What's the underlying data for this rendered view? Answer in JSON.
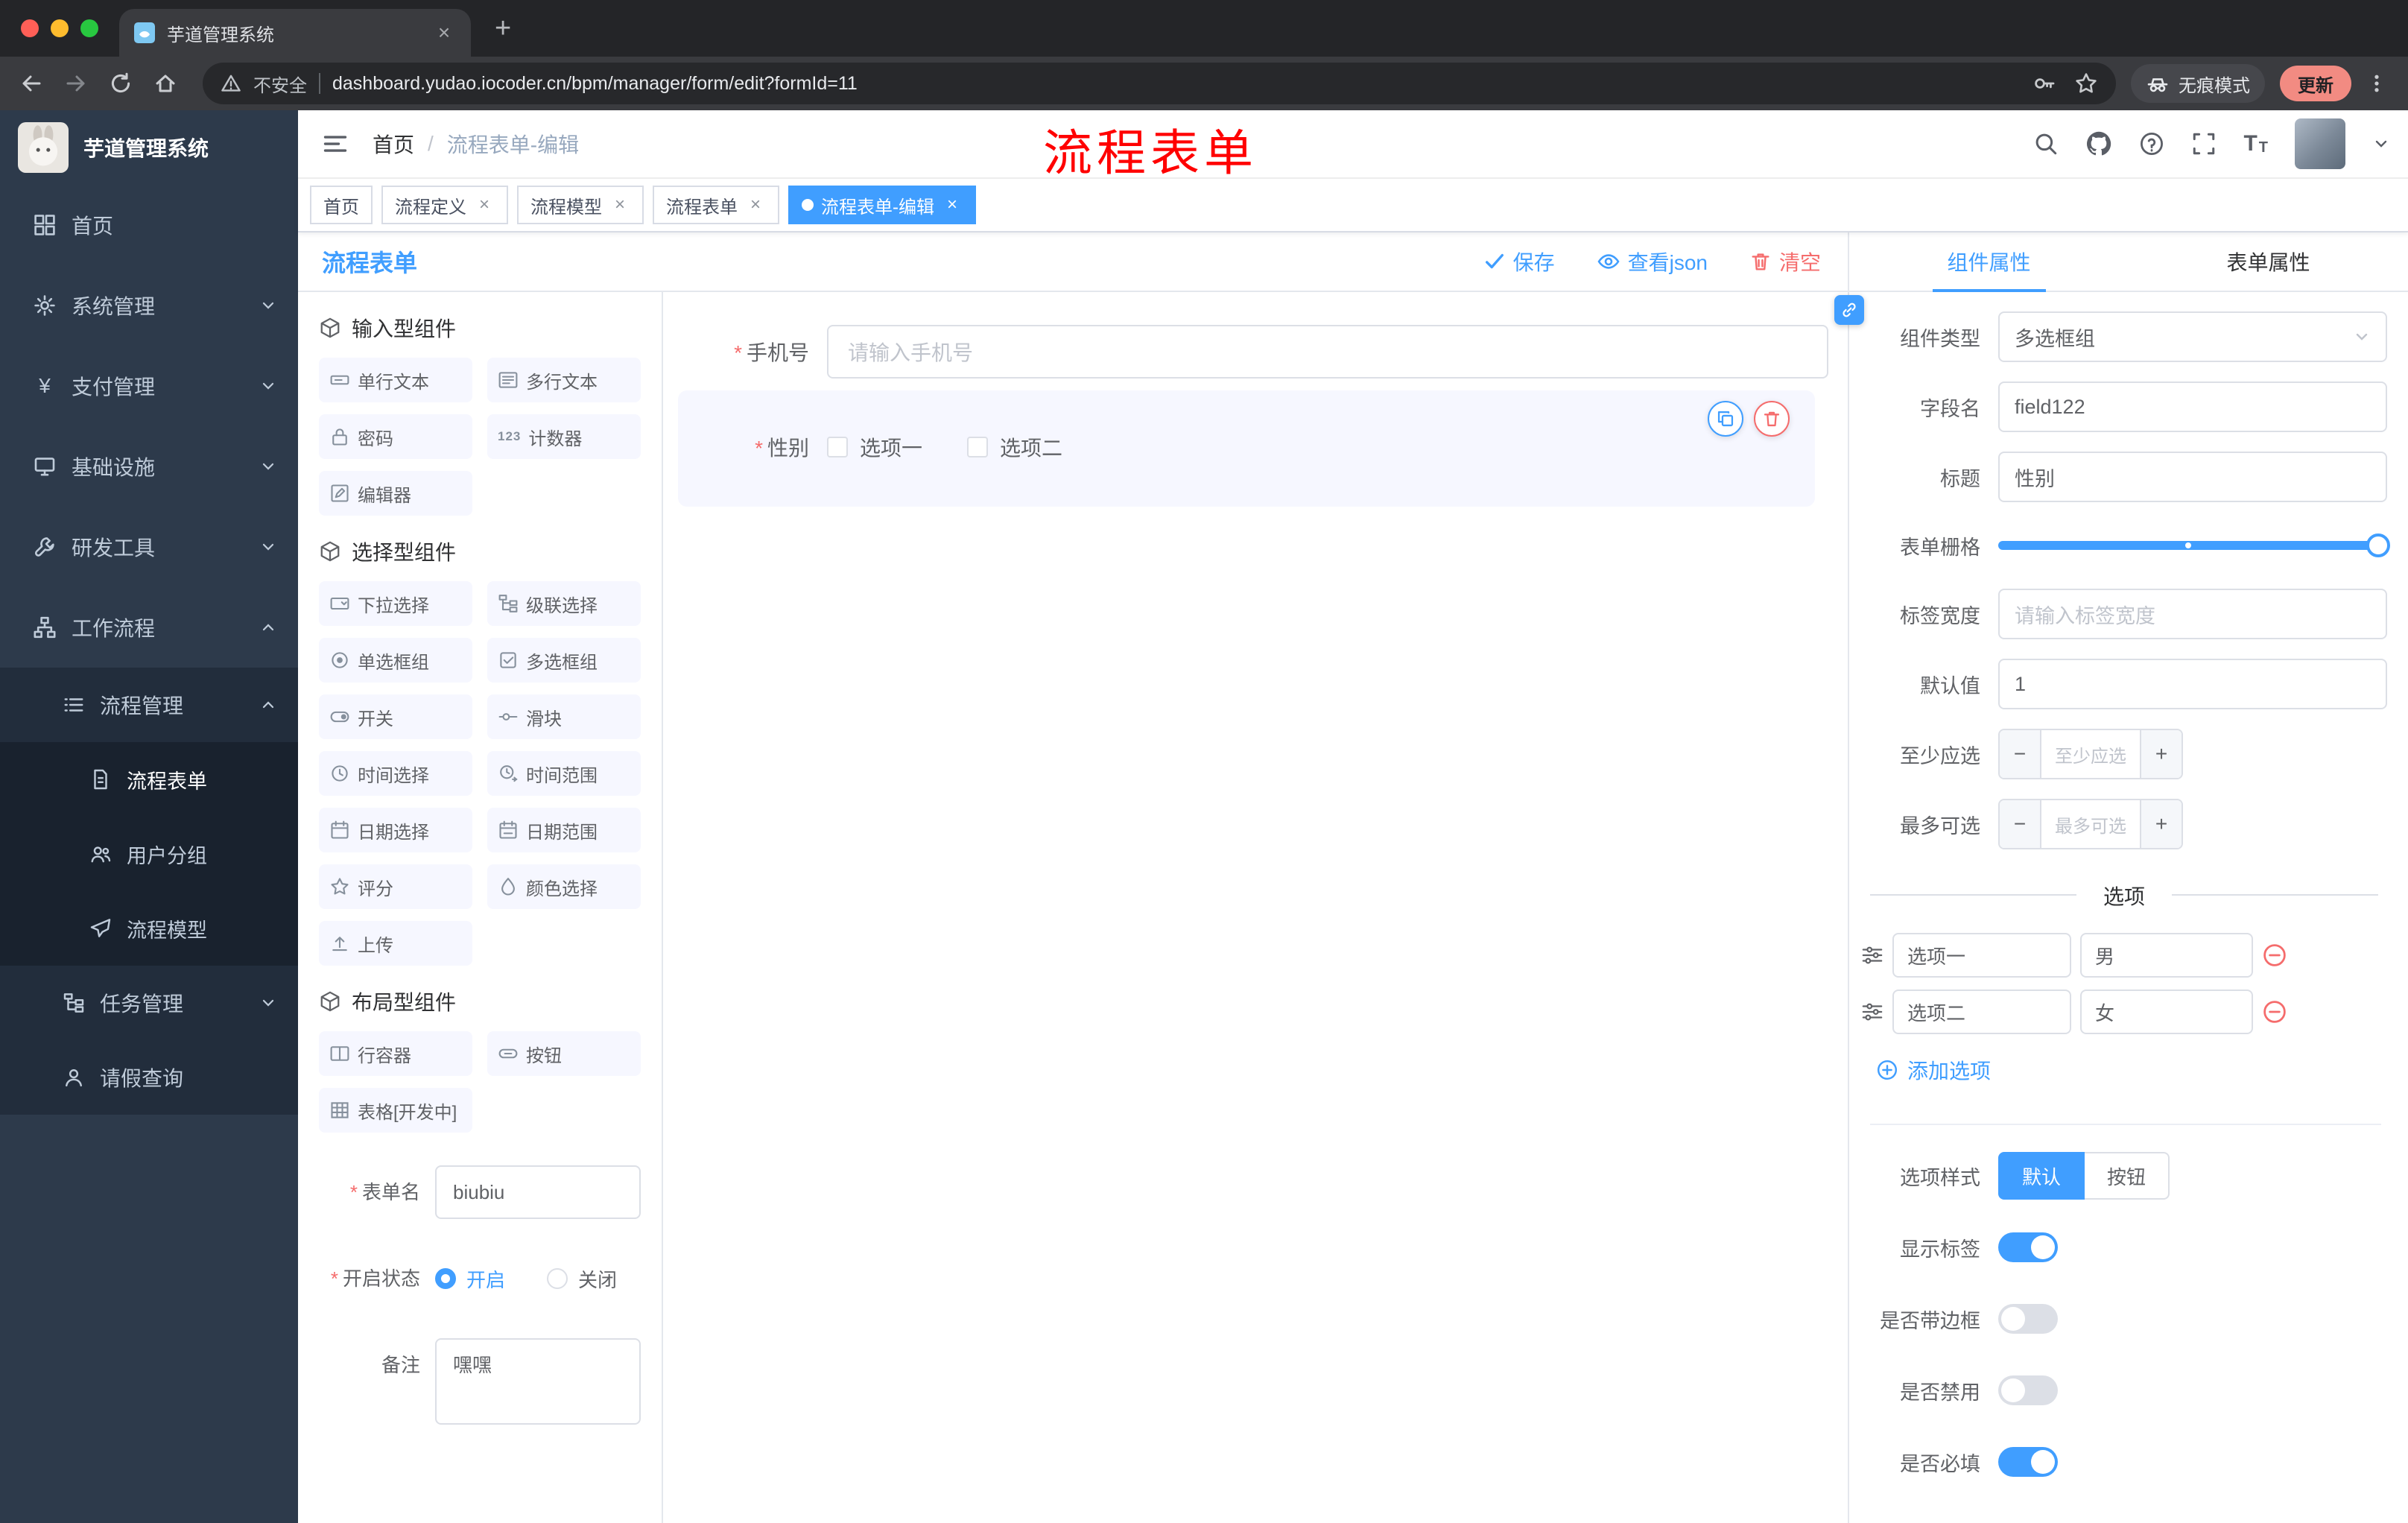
{
  "colors": {
    "primary": "#409eff",
    "danger": "#f56c6c",
    "annotation_red": "#ff0000",
    "sidebar_bg": "#2d3a4b",
    "update_chip": "#f28b82",
    "tag_active": "#409eff"
  },
  "icons": {
    "close": "×",
    "plus": "+",
    "minus": "−",
    "slash": "/",
    "question": "?",
    "asterisk": "*",
    "counter": "123",
    "yen": "¥",
    "font_large": "T",
    "font_small": "T"
  },
  "browser": {
    "tab_title": "芋道管理系统",
    "security_label": "不安全",
    "url": "dashboard.yudao.iocoder.cn/bpm/manager/form/edit?formId=11",
    "incognito_label": "无痕模式",
    "update_label": "更新"
  },
  "sidebar": {
    "logo_title": "芋道管理系统",
    "items": [
      {
        "label": "首页"
      },
      {
        "label": "系统管理"
      },
      {
        "label": "支付管理"
      },
      {
        "label": "基础设施"
      },
      {
        "label": "研发工具"
      },
      {
        "label": "工作流程"
      },
      {
        "label": "流程管理"
      },
      {
        "label": "流程表单"
      },
      {
        "label": "用户分组"
      },
      {
        "label": "流程模型"
      },
      {
        "label": "任务管理"
      },
      {
        "label": "请假查询"
      }
    ]
  },
  "header": {
    "breadcrumb_home": "首页",
    "breadcrumb_current": "流程表单-编辑",
    "annotation": "流程表单"
  },
  "tags": [
    {
      "label": "首页"
    },
    {
      "label": "流程定义"
    },
    {
      "label": "流程模型"
    },
    {
      "label": "流程表单"
    },
    {
      "label": "流程表单-编辑"
    }
  ],
  "editor": {
    "title": "流程表单",
    "save": "保存",
    "view_json": "查看json",
    "clear": "清空",
    "groups": [
      {
        "title": "输入型组件",
        "items": [
          "单行文本",
          "多行文本",
          "密码",
          "计数器",
          "编辑器"
        ]
      },
      {
        "title": "选择型组件",
        "items": [
          "下拉选择",
          "级联选择",
          "单选框组",
          "多选框组",
          "开关",
          "滑块",
          "时间选择",
          "时间范围",
          "日期选择",
          "日期范围",
          "评分",
          "颜色选择",
          "上传"
        ]
      },
      {
        "title": "布局型组件",
        "items": [
          "行容器",
          "按钮",
          "表格[开发中]"
        ]
      }
    ],
    "meta": {
      "name_label": "表单名",
      "name_value": "biubiu",
      "status_label": "开启状态",
      "status_on": "开启",
      "status_off": "关闭",
      "remark_label": "备注",
      "remark_value": "嘿嘿"
    },
    "canvas": {
      "phone_label": "手机号",
      "phone_placeholder": "请输入手机号",
      "gender_label": "性别",
      "gender_opt1": "选项一",
      "gender_opt2": "选项二"
    }
  },
  "props": {
    "tab_component": "组件属性",
    "tab_form": "表单属性",
    "type_label": "组件类型",
    "type_value": "多选框组",
    "field_label": "字段名",
    "field_value": "field122",
    "title_label": "标题",
    "title_value": "性别",
    "grid_label": "表单栅格",
    "labelwidth_label": "标签宽度",
    "labelwidth_placeholder": "请输入标签宽度",
    "default_label": "默认值",
    "default_value": "1",
    "min_label": "至少应选",
    "min_placeholder": "至少应选",
    "max_label": "最多可选",
    "max_placeholder": "最多可选",
    "options_title": "选项",
    "options": [
      {
        "label": "选项一",
        "value": "男"
      },
      {
        "label": "选项二",
        "value": "女"
      }
    ],
    "add_option": "添加选项",
    "style_label": "选项样式",
    "style_default": "默认",
    "style_button": "按钮",
    "switches": [
      {
        "label": "显示标签",
        "on": true
      },
      {
        "label": "是否带边框",
        "on": false
      },
      {
        "label": "是否禁用",
        "on": false
      },
      {
        "label": "是否必填",
        "on": true
      }
    ]
  }
}
